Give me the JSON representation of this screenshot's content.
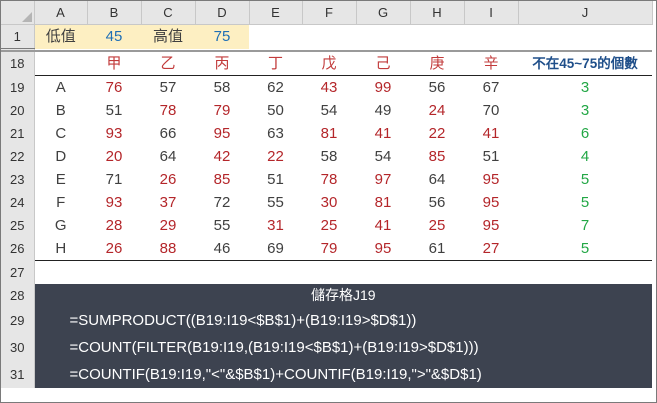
{
  "columns": [
    "A",
    "B",
    "C",
    "D",
    "E",
    "F",
    "G",
    "H",
    "I",
    "J"
  ],
  "row1": {
    "row": "1",
    "label1": "低值",
    "value1": "45",
    "label2": "高值",
    "value2": "75"
  },
  "header_row": {
    "row": "18",
    "names": [
      "甲",
      "乙",
      "丙",
      "丁",
      "戊",
      "己",
      "庚",
      "辛"
    ],
    "j_label": "不在45~75的個數"
  },
  "data_rows": [
    {
      "row": "19",
      "label": "A",
      "values": [
        "76",
        "57",
        "58",
        "62",
        "43",
        "99",
        "56",
        "67"
      ],
      "count": "3"
    },
    {
      "row": "20",
      "label": "B",
      "values": [
        "51",
        "78",
        "79",
        "50",
        "54",
        "49",
        "24",
        "70"
      ],
      "count": "3"
    },
    {
      "row": "21",
      "label": "C",
      "values": [
        "93",
        "66",
        "95",
        "63",
        "81",
        "41",
        "22",
        "41"
      ],
      "count": "6"
    },
    {
      "row": "22",
      "label": "D",
      "values": [
        "20",
        "64",
        "42",
        "22",
        "58",
        "54",
        "85",
        "51"
      ],
      "count": "4"
    },
    {
      "row": "23",
      "label": "E",
      "values": [
        "71",
        "26",
        "85",
        "51",
        "78",
        "97",
        "64",
        "95"
      ],
      "count": "5"
    },
    {
      "row": "24",
      "label": "F",
      "values": [
        "93",
        "37",
        "72",
        "55",
        "30",
        "81",
        "56",
        "95"
      ],
      "count": "5"
    },
    {
      "row": "25",
      "label": "G",
      "values": [
        "28",
        "29",
        "55",
        "31",
        "25",
        "41",
        "25",
        "95"
      ],
      "count": "7"
    },
    {
      "row": "26",
      "label": "H",
      "values": [
        "26",
        "88",
        "46",
        "69",
        "79",
        "95",
        "61",
        "27"
      ],
      "count": "5"
    }
  ],
  "row27": {
    "row": "27"
  },
  "formula_block": {
    "title_row": "28",
    "title": "儲存格J19",
    "lines": [
      {
        "row": "29",
        "text": "=SUMPRODUCT((B19:I19<$B$1)+(B19:I19>$D$1))"
      },
      {
        "row": "30",
        "text": "=COUNT(FILTER(B19:I19,(B19:I19<$B$1)+(B19:I19>$D$1)))"
      },
      {
        "row": "31",
        "text": "=COUNTIF(B19:I19,\"<\"&$B$1)+COUNTIF(B19:I19,\">\"&$D$1)"
      }
    ]
  },
  "colors": {
    "low_high_value": "#1f6fb5",
    "out_of_range": "#b4262a",
    "in_range": "#404040",
    "count": "#22a745",
    "formula_bg": "#3d4350"
  }
}
